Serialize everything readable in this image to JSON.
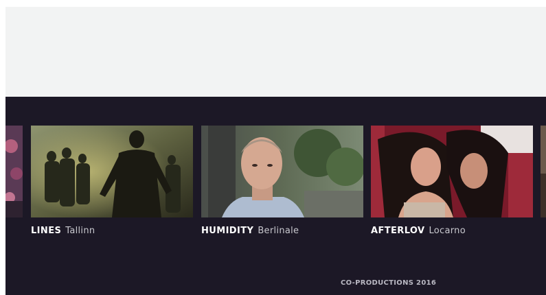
{
  "films": [
    {
      "title": "LINES",
      "festival": "Tallinn"
    },
    {
      "title": "HUMIDITY",
      "festival": "Berlinale"
    },
    {
      "title": "AFTERLOV",
      "festival": "Locarno"
    }
  ],
  "section_caption": "CO-PRODUCTIONS 2016"
}
